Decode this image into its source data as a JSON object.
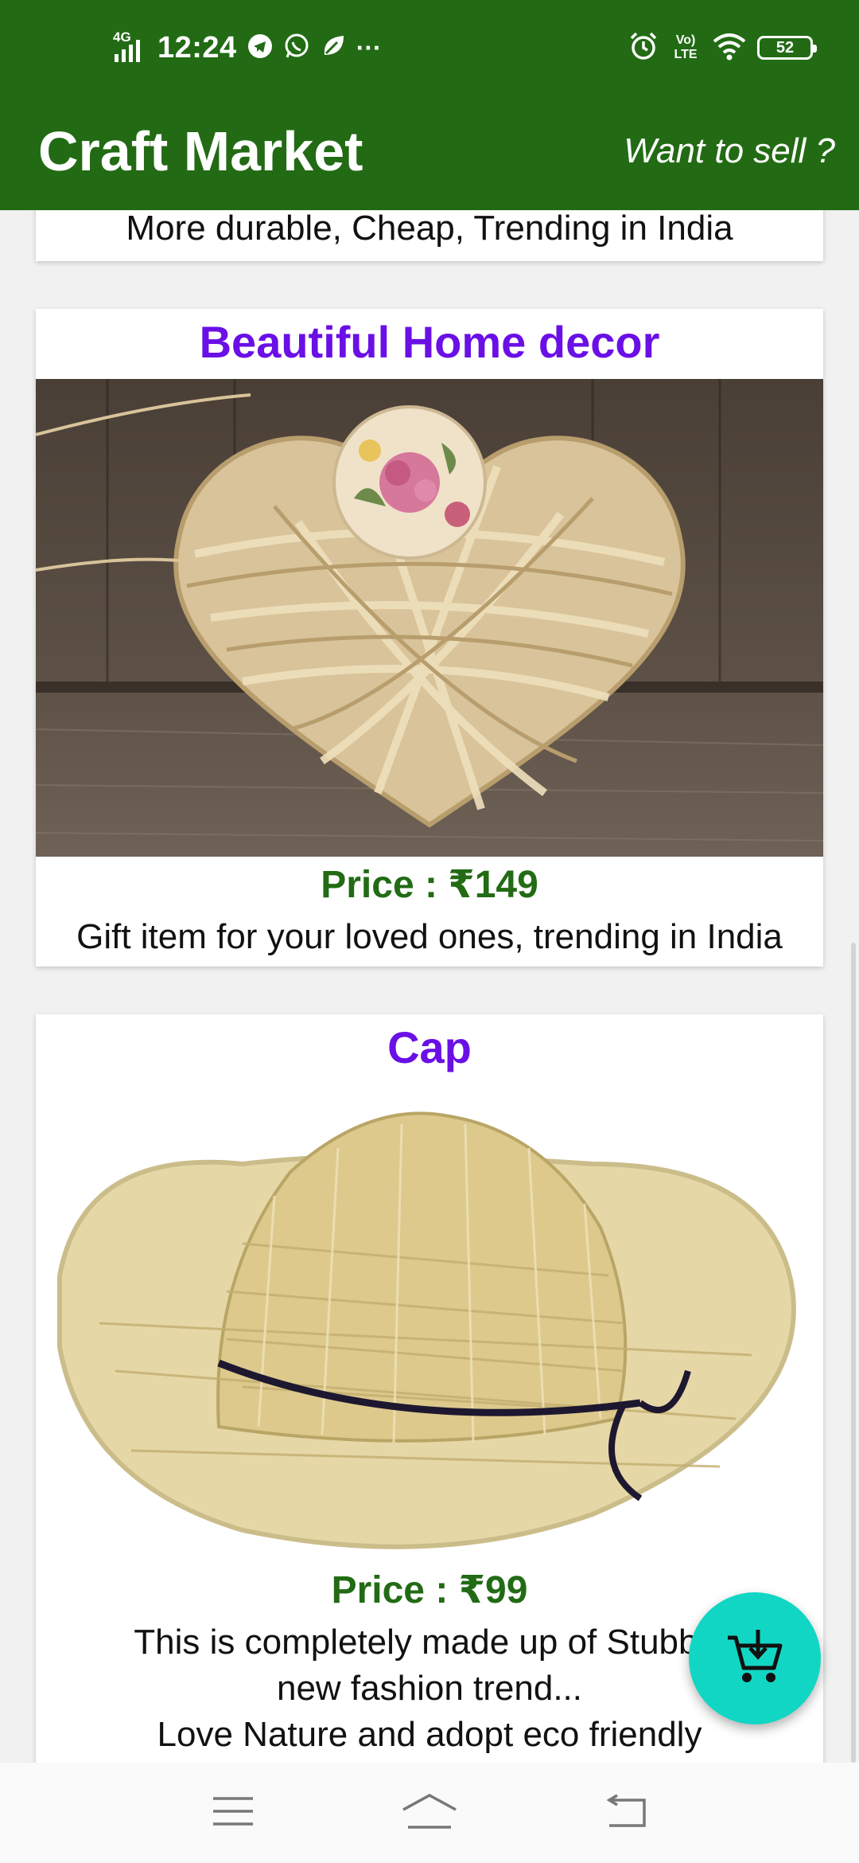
{
  "status_bar": {
    "network": "4G",
    "time": "12:24",
    "volte_label": "Vo) LTE",
    "battery": "52",
    "more_indicator": "···"
  },
  "app": {
    "title": "Craft Market",
    "sell_link": "Want to sell ?",
    "theme_color": "#226b14",
    "title_color": "#6a0fe6",
    "fab_color": "#12d6c4"
  },
  "products": [
    {
      "description": "More durable, Cheap, Trending in India"
    },
    {
      "title": "Beautiful Home decor",
      "price": "Price : ₹149",
      "description": "Gift item for your loved ones, trending in India",
      "image_icon": "woven-heart-image"
    },
    {
      "title": "Cap",
      "price": "Price : ₹99",
      "description_lines": [
        "This is completely made up of Stubble",
        "new fashion trend...",
        "Love Nature and adopt eco friendly"
      ],
      "image_icon": "straw-hat-image"
    }
  ],
  "icons": {
    "fab": "cart-download-icon",
    "nav_menu": "menu-icon",
    "nav_home": "home-icon",
    "nav_back": "back-icon"
  }
}
